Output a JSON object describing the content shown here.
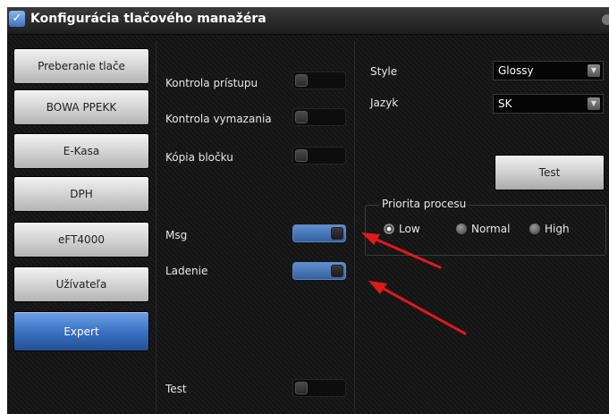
{
  "window": {
    "title": "Konfigurácia tlačového manažéra"
  },
  "sidebar": {
    "items": [
      {
        "label": "Preberanie tlače",
        "active": false
      },
      {
        "label": "BOWA PPEKK",
        "active": false
      },
      {
        "label": "E-Kasa",
        "active": false
      },
      {
        "label": "DPH",
        "active": false
      },
      {
        "label": "eFT4000",
        "active": false
      },
      {
        "label": "Užívateľa",
        "active": false
      },
      {
        "label": "Expert",
        "active": true
      }
    ]
  },
  "toggles": {
    "kontrola_pristupu": {
      "label": "Kontrola prístupu",
      "on": false
    },
    "kontrola_vymazania": {
      "label": "Kontrola vymazania",
      "on": false
    },
    "kopia_blocku": {
      "label": "Kópia bločku",
      "on": false
    },
    "msg": {
      "label": "Msg",
      "on": true
    },
    "ladenie": {
      "label": "Ladenie",
      "on": true
    },
    "test": {
      "label": "Test",
      "on": false
    }
  },
  "settings": {
    "style": {
      "label": "Style",
      "value": "Glossy"
    },
    "jazyk": {
      "label": "Jazyk",
      "value": "SK"
    },
    "test_button": "Test"
  },
  "priority": {
    "title": "Priorita procesu",
    "options": [
      {
        "label": "Low",
        "selected": true
      },
      {
        "label": "Normal",
        "selected": false
      },
      {
        "label": "High",
        "selected": false
      }
    ]
  },
  "colors": {
    "accent": "#3b73c4",
    "annotation_arrow": "#e0191b"
  }
}
